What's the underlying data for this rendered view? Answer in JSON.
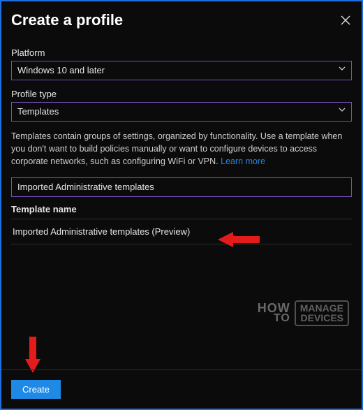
{
  "header": {
    "title": "Create a profile"
  },
  "fields": {
    "platform_label": "Platform",
    "platform_value": "Windows 10 and later",
    "profile_type_label": "Profile type",
    "profile_type_value": "Templates"
  },
  "description": {
    "text": "Templates contain groups of settings, organized by functionality. Use a template when you don't want to build policies manually or want to configure devices to access corporate networks, such as configuring WiFi or VPN. ",
    "link": "Learn more"
  },
  "search": {
    "value": "Imported Administrative templates"
  },
  "table": {
    "column": "Template name",
    "rows": [
      "Imported Administrative templates (Preview)"
    ]
  },
  "footer": {
    "create": "Create"
  },
  "watermark": {
    "l1": "HOW",
    "l2": "TO",
    "b1": "MANAGE",
    "b2": "DEVICES"
  }
}
